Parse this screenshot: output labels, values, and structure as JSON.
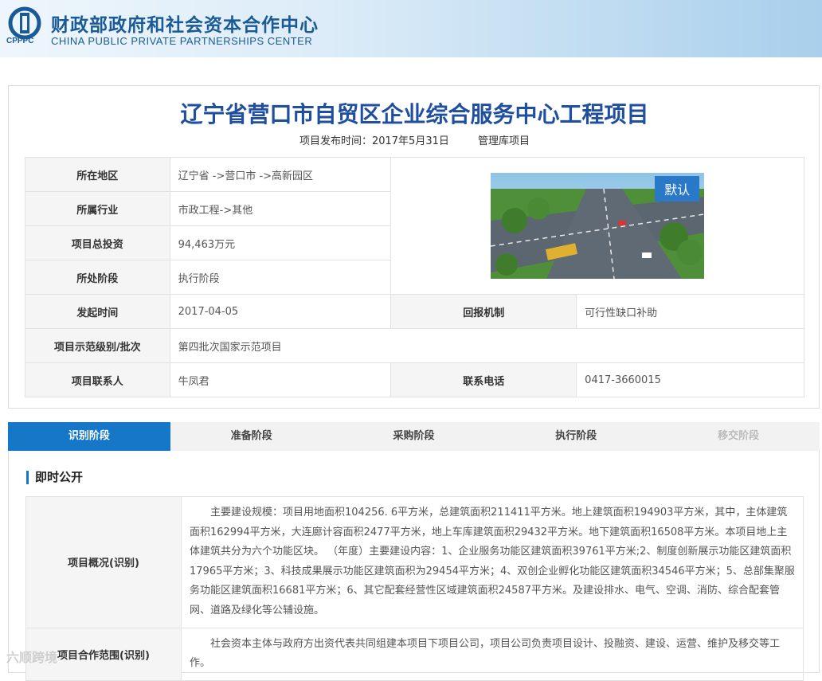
{
  "header": {
    "cn_name": "财政部政府和社会资本合作中心",
    "en_name": "CHINA PUBLIC PRIVATE PARTNERSHIPS CENTER",
    "abbr": "CPPPC",
    "brand_color": "#1a5a96"
  },
  "project": {
    "title": "辽宁省营口市自贸区企业综合服务中心工程项目",
    "publish_time": "项目发布时间：2017年5月31日",
    "library": "管理库项目",
    "image_badge": "默认"
  },
  "info": {
    "region_label": "所在地区",
    "region_value": "辽宁省 ->营口市 ->高新园区",
    "industry_label": "所属行业",
    "industry_value": "市政工程->其他",
    "investment_label": "项目总投资",
    "investment_value": "94,463万元",
    "stage_label": "所处阶段",
    "stage_value": "执行阶段",
    "start_label": "发起时间",
    "start_value": "2017-04-05",
    "return_label": "回报机制",
    "return_value": "可行性缺口补助",
    "demo_label": "项目示范级别/批次",
    "demo_value": "第四批次国家示范项目",
    "contact_label": "项目联系人",
    "contact_value": "牛凤君",
    "phone_label": "联系电话",
    "phone_value": "0417-3660015"
  },
  "tabs": [
    {
      "label": "识别阶段",
      "state": "active"
    },
    {
      "label": "准备阶段",
      "state": "normal"
    },
    {
      "label": "采购阶段",
      "state": "normal"
    },
    {
      "label": "执行阶段",
      "state": "normal"
    },
    {
      "label": "移交阶段",
      "state": "disabled"
    }
  ],
  "panel": {
    "section_title": "即时公开",
    "overview_label": "项目概况(识别)",
    "overview_text": "主要建设规模：项目用地面积104256. 6平方米，总建筑面积211411平方米。地上建筑面积194903平方米，其中，主体建筑面积162994平方米，大连廊计容面积2477平方米，地上车库建筑面积29432平方米。地下建筑面积16508平方米。本项目地上主体建筑共分为六个功能区块。 （年度）主要建设内容：1、企业服务功能区建筑面积39761平方米;2、制度创新展示功能区建筑面积17965平方米；3、科技成果展示功能区建筑面积为29454平方米；4、双创企业孵化功能区建筑面积34546平方米；5、总部集聚服务功能区建筑面积16681平方米；6、其它配套经营性区域建筑面积24587平方米。及建设排水、电气、空调、消防、综合配套管网、道路及绿化等公辅设施。",
    "scope_label": "项目合作范围(识别)",
    "scope_text": "社会资本主体与政府方出资代表共同组建本项目下项目公司，项目公司负责项目设计、投融资、建设、运营、维护及移交等工作。"
  },
  "watermark": "六顺跨境",
  "colors": {
    "accent": "#1677c9",
    "title": "#1f4f9e"
  }
}
